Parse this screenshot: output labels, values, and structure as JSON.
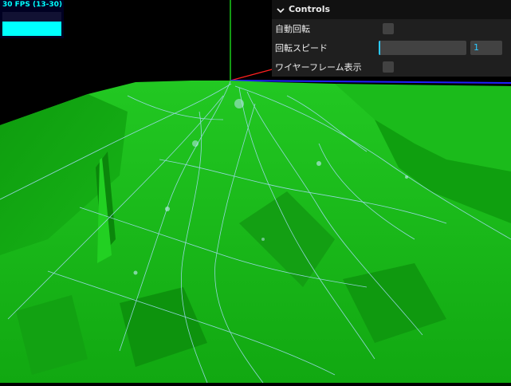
{
  "stats": {
    "fps_text": "30 FPS (13-30)",
    "history_level": 0.6,
    "color": "#00ffff"
  },
  "controls": {
    "title": "Controls",
    "auto_rotate": {
      "label": "自動回転",
      "checked": false
    },
    "rotate_speed": {
      "label": "回転スピード",
      "value": "1",
      "level": 0.0
    },
    "wireframe": {
      "label": "ワイヤーフレーム表示",
      "checked": false
    }
  },
  "scene": {
    "background": "#000000",
    "terrain_color": "#11aa11",
    "road_color": "#aaddff",
    "axis_colors": {
      "x": "#ff2020",
      "y": "#20ff20",
      "z": "#2020ff"
    }
  }
}
